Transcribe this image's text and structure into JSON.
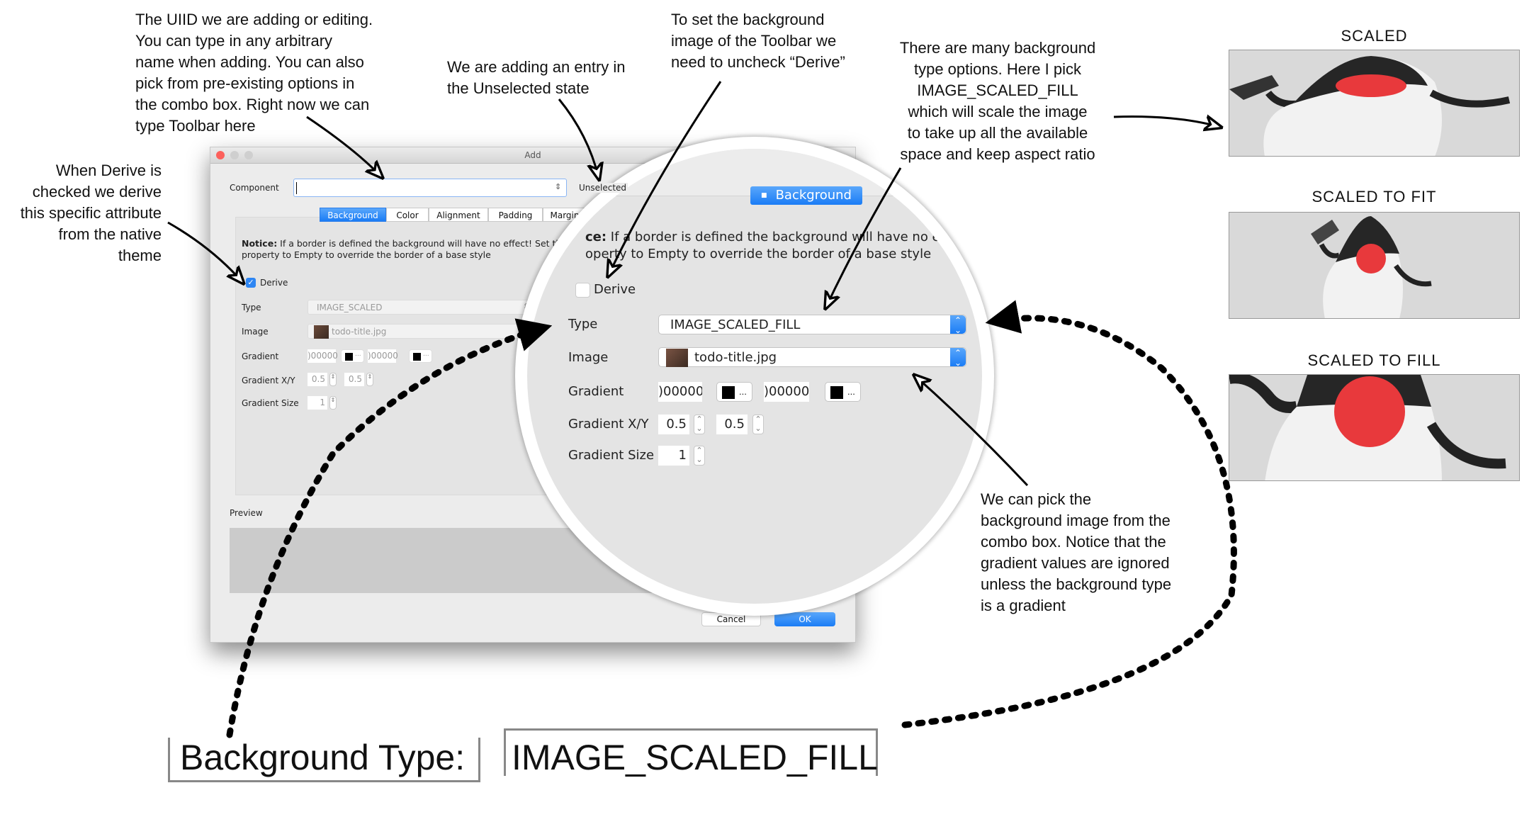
{
  "annotations": {
    "uiid_note": "The UIID we are adding or editing.\nYou can type in any arbitrary\nname when adding. You can also\npick from pre-existing options in\nthe combo box. Right now we can\ntype Toolbar here",
    "unselected_note": "We are adding an entry in\nthe Unselected state",
    "derive_uncheck_note": "To set the background\nimage of the Toolbar we\nneed to uncheck “Derive”",
    "type_options_note": "There are many background\ntype options. Here I pick\nIMAGE_SCALED_FILL\nwhich will scale the image\nto take up all the available\nspace and keep aspect ratio",
    "derive_note": "When Derive is\nchecked we derive\nthis specific attribute\nfrom the native\ntheme",
    "image_note": "We can pick the\nbackground image from the\ncombo box. Notice that the\ngradient values are ignored\nunless the background type\nis a gradient"
  },
  "dialog": {
    "title": "Add",
    "component_label": "Component",
    "component_value": "",
    "state_label": "Unselected",
    "tabs": [
      {
        "label": "Background",
        "selected": true
      },
      {
        "label": "Color"
      },
      {
        "label": "Alignment"
      },
      {
        "label": "Padding"
      },
      {
        "label": "Margin"
      }
    ],
    "notice_bold": "Notice:",
    "notice_text": " If a border is defined the background will have no effect! Set the b",
    "notice_text2": "property to Empty to override the border of a base style",
    "derive_label": "Derive",
    "derive_checked": true,
    "type_label": "Type",
    "type_value": "IMAGE_SCALED",
    "image_label": "Image",
    "image_value": "todo-title.jpg",
    "gradient_label": "Gradient",
    "gradient_color1": ")00000",
    "gradient_color2": ")00000",
    "color_button_label": "...",
    "gradient_xy_label": "Gradient X/Y",
    "gradient_x": "0.5",
    "gradient_y": "0.5",
    "gradient_size_label": "Gradient Size",
    "gradient_size": "1",
    "preview_label": "Preview",
    "cancel_label": "Cancel",
    "ok_label": "OK"
  },
  "magnified": {
    "tab_label": "Background",
    "notice_bold": "ce:",
    "notice_text": " If a border is defined the background will have no e",
    "notice_text2": "operty to Empty to override the border of a base style",
    "derive_label": "Derive",
    "derive_checked": false,
    "type_label": "Type",
    "type_value": "IMAGE_SCALED_FILL",
    "image_label": "Image",
    "image_value": "todo-title.jpg",
    "gradient_label": "Gradient",
    "gradient_color1": ")00000",
    "gradient_color2": ")00000",
    "color_button_label": "...",
    "gradient_xy_label": "Gradient X/Y",
    "gradient_x": "0.5",
    "gradient_y": "0.5",
    "gradient_size_label": "Gradient Size",
    "gradient_size": "1"
  },
  "examples": [
    {
      "label": "SCALED"
    },
    {
      "label": "SCALED TO FIT"
    },
    {
      "label": "SCALED TO FILL"
    }
  ],
  "callout": {
    "label": "Background Type:",
    "value": "IMAGE_SCALED_FILL"
  },
  "colors": {
    "accent": "#1a7cf5",
    "nose": "#e8393c"
  }
}
